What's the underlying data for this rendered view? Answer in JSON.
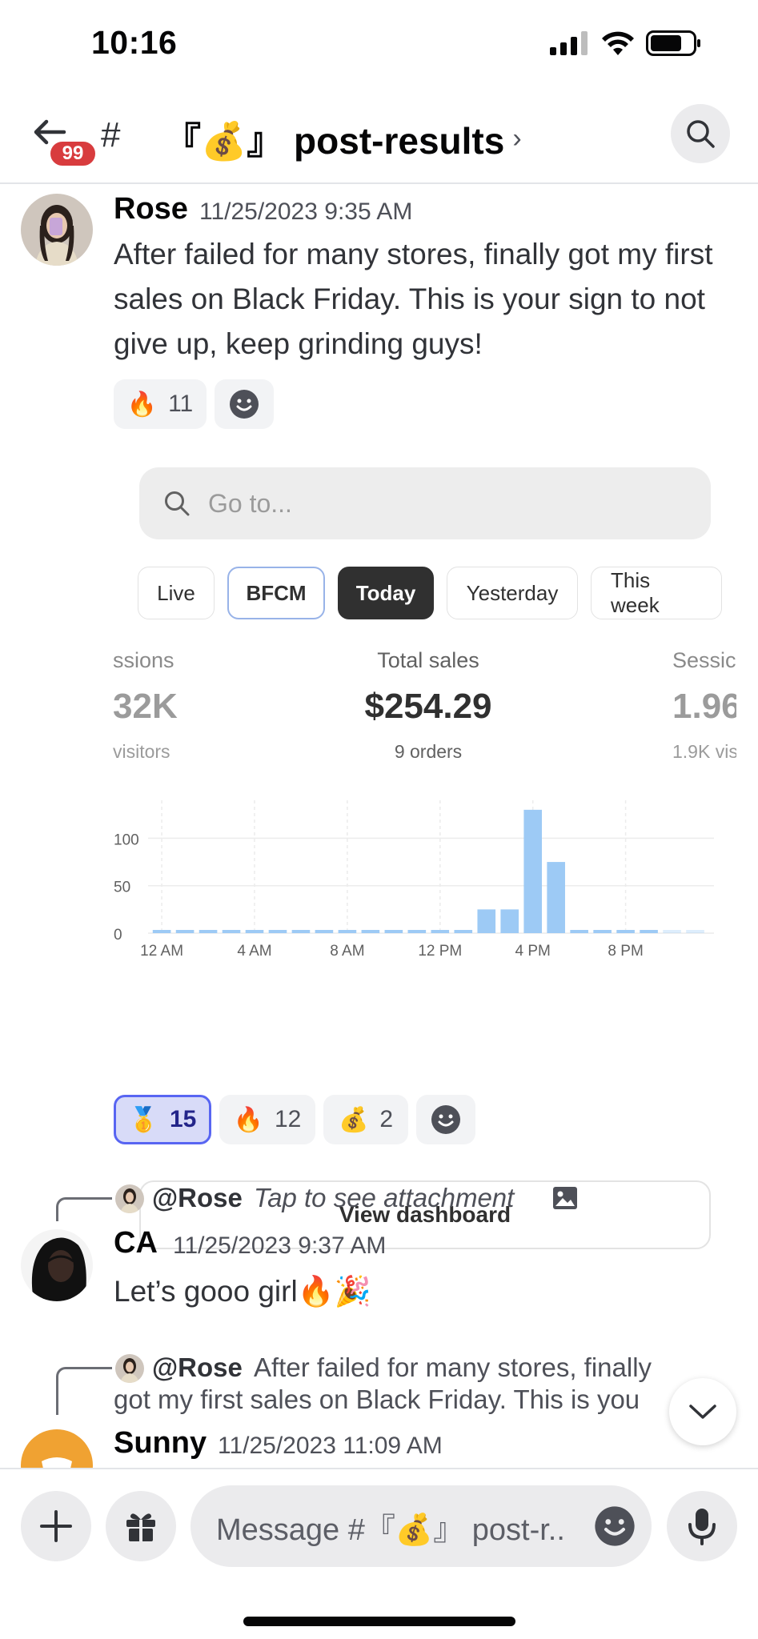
{
  "status_bar": {
    "time": "10:16"
  },
  "header": {
    "back_badge": "99",
    "channel_prefix": "#",
    "channel_name": "『💰』 post-results",
    "chevron": "›"
  },
  "messages": [
    {
      "author": "Rose",
      "timestamp": "11/25/2023 9:35 AM",
      "text": "After failed for many stores, finally got my first sales on Black Friday. This is your sign to not give up, keep grinding guys!",
      "reactions": [
        {
          "emoji": "🔥",
          "count": "11"
        }
      ],
      "bottom_reactions": [
        {
          "emoji": "🥇",
          "count": "15",
          "active": true
        },
        {
          "emoji": "🔥",
          "count": "12"
        },
        {
          "emoji": "💰",
          "count": "2"
        }
      ]
    },
    {
      "reply_to": "@Rose",
      "reply_text": "Tap to see attachment",
      "author": "CA",
      "timestamp": "11/25/2023 9:37 AM",
      "text": "Let’s gooo girl🔥🎉"
    },
    {
      "reply_to": "@Rose",
      "reply_text_line1": "After failed for many stores, finally",
      "reply_text_line2": "got my first sales on Black Friday. This is you",
      "author": "Sunny",
      "timestamp": "11/25/2023 11:09 AM"
    }
  ],
  "embed": {
    "search_placeholder": "Go to...",
    "periods": [
      "Live",
      "BFCM",
      "Today",
      "Yesterday",
      "This week"
    ],
    "selected_period": "Today",
    "metrics": {
      "left_label": "ssions",
      "left_value": "32K",
      "left_sub": "visitors",
      "center_label": "Total sales",
      "center_value": "$254.29",
      "center_sub": "9 orders",
      "right_label": "Sessic",
      "right_value": "1.96",
      "right_sub": "1.9K vis"
    },
    "view_dashboard": "View dashboard"
  },
  "chart_data": {
    "type": "bar",
    "categories": [
      "12 AM",
      "1 AM",
      "2 AM",
      "3 AM",
      "4 AM",
      "5 AM",
      "6 AM",
      "7 AM",
      "8 AM",
      "9 AM",
      "10 AM",
      "11 AM",
      "12 PM",
      "1 PM",
      "2 PM",
      "3 PM",
      "4 PM",
      "5 PM",
      "6 PM",
      "7 PM",
      "8 PM",
      "9 PM",
      "10 PM",
      "11 PM"
    ],
    "x_tick_labels": [
      "12 AM",
      "4 AM",
      "8 AM",
      "12 PM",
      "4 PM",
      "8 PM"
    ],
    "values": [
      0,
      0,
      0,
      0,
      0,
      0,
      0,
      0,
      0,
      0,
      0,
      0,
      0,
      0,
      25,
      25,
      130,
      75,
      0,
      0,
      0,
      0,
      0,
      0
    ],
    "y_ticks": [
      "0",
      "50",
      "100"
    ],
    "ylim": [
      0,
      140
    ],
    "grid": true,
    "colors": {
      "bar": "#9dcaf5",
      "baseline": "#9dcaf5"
    }
  },
  "composer": {
    "placeholder": "Message #『💰』 post-r.."
  },
  "colors": {
    "accent": "#5865f2",
    "badge": "#d83c3e",
    "dark_pill": "#303030"
  }
}
